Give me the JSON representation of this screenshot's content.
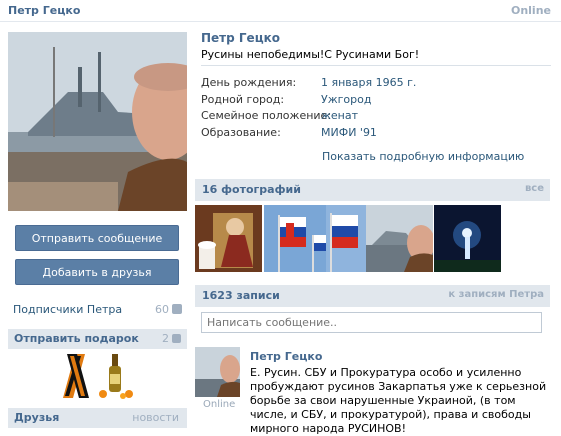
{
  "header": {
    "name": "Петр Гецко",
    "online": "Online"
  },
  "profile": {
    "name": "Петр Гецко",
    "status": "Русины непобедимы!С Русинами Бог!",
    "info": [
      {
        "label": "День рождения:",
        "value": "1 января 1965 г."
      },
      {
        "label": "Родной город:",
        "value": "Ужгород"
      },
      {
        "label": "Семейное положение:",
        "value": "женат"
      },
      {
        "label": "Образование:",
        "value": "МИФИ '91"
      }
    ],
    "show_more": "Показать подробную информацию"
  },
  "actions": {
    "send_message": "Отправить сообщение",
    "add_friend": "Добавить в друзья"
  },
  "subscribers": {
    "label": "Подписчики Петра",
    "count": "60"
  },
  "gifts": {
    "label": "Отправить подарок",
    "count": "2"
  },
  "friends": {
    "label": "Друзья",
    "link": "новости"
  },
  "photos": {
    "title": "16 фотографий",
    "link": "все"
  },
  "wall": {
    "title": "1623 записи",
    "link": "к записям Петра",
    "placeholder": "Написать сообщение..",
    "post": {
      "author": "Петр Гецко",
      "status": "Online",
      "text": "Е. Русин. СБУ и Прокуратура особо и усиленно пробуждают русинов Закарпатья уже к серьезной борьбе за свои нарушенные Украиной, (в том числе, и СБУ, и прокуратурой), права и свободы мирного народа РУСИНОВ!"
    }
  },
  "colors": {
    "accent": "#45688e",
    "button": "#5b7fa6",
    "section": "#e1e7ed"
  }
}
